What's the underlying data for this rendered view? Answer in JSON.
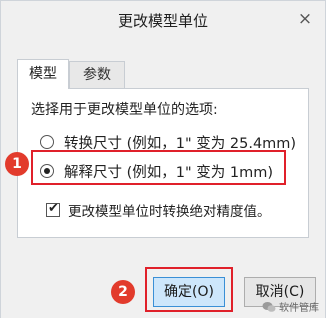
{
  "dialog": {
    "title": "更改模型单位",
    "close_icon": "×"
  },
  "tabs": [
    {
      "label": "模型",
      "active": true
    },
    {
      "label": "参数",
      "active": false
    }
  ],
  "panel": {
    "section_label": "选择用于更改模型单位的选项:",
    "options": [
      {
        "label": "转换尺寸 (例如，1\" 变为 25.4mm)",
        "selected": false
      },
      {
        "label": "解释尺寸 (例如，1\" 变为 1mm)",
        "selected": true
      }
    ],
    "checkbox": {
      "label": "更改模型单位时转换绝对精度值。",
      "checked": true,
      "tick": "✔"
    }
  },
  "buttons": {
    "ok": "确定(O)",
    "cancel": "取消(C)"
  },
  "annotations": {
    "step1": "1",
    "step2": "2",
    "highlight_color": "#e0202a",
    "badge_color": "#e23b2c"
  },
  "watermark": {
    "text": "软件管库",
    "icon": "wechat-icon"
  }
}
